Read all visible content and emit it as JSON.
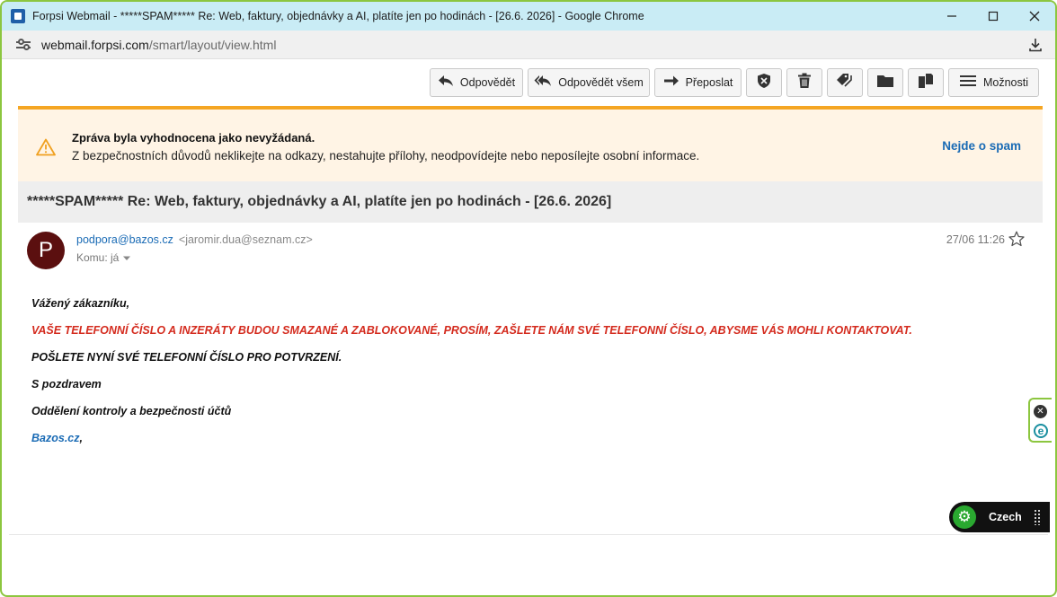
{
  "browser": {
    "window_title": "Forpsi Webmail - *****SPAM***** Re: Web, faktury, objednávky a AI, platíte jen po hodinách - [26.6. 2026] - Google Chrome",
    "url_host": "webmail.forpsi.com",
    "url_path": "/smart/layout/view.html"
  },
  "toolbar": {
    "reply": "Odpovědět",
    "reply_all": "Odpovědět všem",
    "forward": "Přeposlat",
    "more": "Možnosti"
  },
  "spam_banner": {
    "title": "Zpráva byla vyhodnocena jako nevyžádaná.",
    "text": "Z bezpečnostních důvodů neklikejte na odkazy, nestahujte přílohy, neodpovídejte nebo neposílejte osobní informace.",
    "not_spam": "Nejde o spam"
  },
  "message": {
    "subject": "*****SPAM***** Re: Web, faktury, objednávky a AI, platíte jen po hodinách - [26.6. 2026]",
    "avatar_letter": "P",
    "sender_name": "podpora@bazos.cz",
    "sender_email": "<jaromir.dua@seznam.cz>",
    "to": "Komu: já",
    "date": "27/06 11:26",
    "body": {
      "greeting": "Vážený zákazníku,",
      "warning": "VAŠE TELEFONNÍ ČÍSLO A INZERÁTY BUDOU SMAZANÉ A ZABLOKOVANÉ, PROSÍM, ZAŠLETE NÁM SVÉ TELEFONNÍ ČÍSLO, ABYSME VÁS MOHLI KONTAKTOVAT.",
      "request": "POŠLETE NYNÍ SVÉ TELEFONNÍ ČÍSLO PRO POTVRZENÍ.",
      "closing": "S pozdravem",
      "department": "Oddělení kontroly a bezpečnosti účtů",
      "link": "Bazos.cz",
      "link_suffix": ","
    }
  },
  "lang_widget": {
    "label": "Czech"
  },
  "colors": {
    "accent_green": "#8cc63f",
    "banner_bg": "#fff4e5",
    "banner_border": "#f5a623",
    "link_blue": "#1a6bb5",
    "warning_red": "#d42b1e",
    "avatar_bg": "#5b0f0f"
  }
}
